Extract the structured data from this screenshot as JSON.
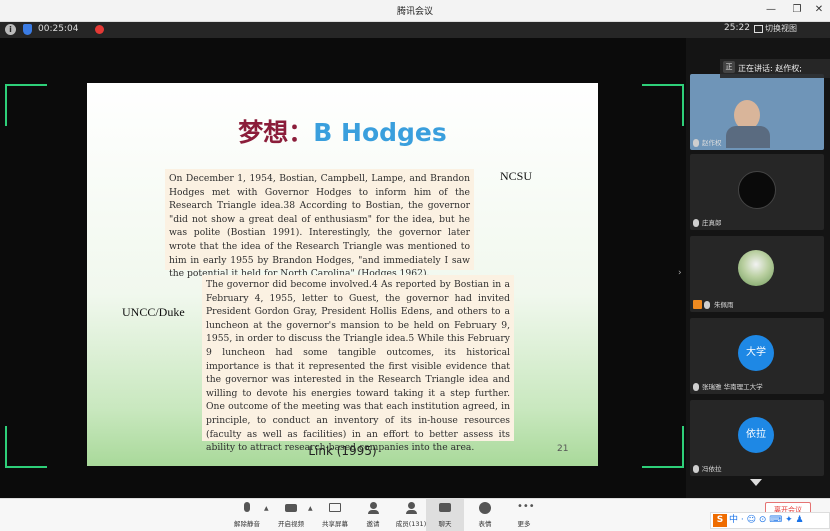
{
  "window": {
    "title": "腾讯会议",
    "minimize_glyph": "—",
    "restore_glyph": "❐",
    "close_glyph": "✕"
  },
  "infobar": {
    "info_glyph": "i",
    "timer": "00:25:04",
    "clock": "25:22",
    "view_switch": "切换视图"
  },
  "slide": {
    "title_cn": "梦想：",
    "title_en": "B Hodges",
    "label_right": "NCSU",
    "label_left": "UNCC/Duke",
    "excerpt1": "On December 1, 1954, Bostian, Campbell, Lampe, and Brandon Hodges met with Governor Hodges to inform him of the Research Triangle idea.38 According to Bostian, the governor \"did not show a great deal of enthusiasm\" for the idea, but he was polite (Bostian 1991). Interestingly, the governor later wrote that the idea of the Research Triangle was mentioned to him in early 1955 by Brandon Hodges, \"and immediately I saw the potential it held for North Carolina\" (Hodges 1962).",
    "excerpt2": "The governor did become involved.4 As reported by Bostian in a February 4, 1955, letter to Guest, the governor had invited President Gordon Gray, President Hollis Edens, and others to a luncheon at the governor's mansion to be held on February 9, 1955, in order to discuss the Triangle idea.5 While this February 9 luncheon had some tangible outcomes, its historical importance is that it represented the first visible evidence that the governor was interested in the Research Triangle idea and willing to devote his energies toward taking it a step further. One outcome of the meeting was that each institution agreed, in principle, to conduct an inventory of its in-house resources (faculty as well as facilities) in an effort to better assess its ability to attract research-based companies into the area.",
    "caption": "Link (1995)",
    "page_number": "21"
  },
  "sidebar": {
    "speaker_badge": "正",
    "speaker_text": "正在讲话: 赵作权;",
    "participants": [
      {
        "name": "赵作权"
      },
      {
        "name": "庄真郎"
      },
      {
        "name": "朱佩雨"
      },
      {
        "name": "张瑞雅 华南理工大学",
        "avatar_text": "大学"
      },
      {
        "name": "冯依拉",
        "avatar_text": "依拉"
      }
    ],
    "scroll_glyph": "›"
  },
  "toolbar": {
    "buttons": [
      {
        "label": "解除静音"
      },
      {
        "label": "开启视频"
      },
      {
        "label": "共享屏幕"
      },
      {
        "label": "邀请"
      },
      {
        "label": "成员(131)"
      },
      {
        "label": "聊天"
      },
      {
        "label": "表情"
      },
      {
        "label": "更多"
      }
    ],
    "end_meeting": "离开会议"
  },
  "ime": {
    "logo": "S",
    "text": "中 · ☺ ⊙ ⌨ ✦ ♟"
  },
  "colors": {
    "accent_green": "#2ecf79",
    "title_red": "#8b1d3a",
    "title_blue": "#3a9fdd",
    "avatar_blue": "#1e88e5",
    "record_red": "#e53935"
  }
}
